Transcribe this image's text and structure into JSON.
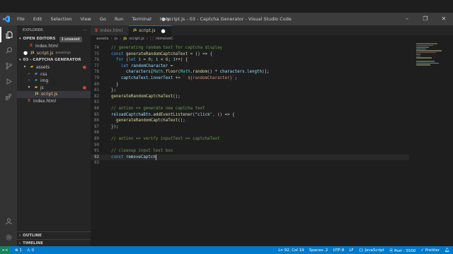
{
  "titlebar": {
    "logo_icon": "vscode-logo",
    "menu": [
      "File",
      "Edit",
      "Selection",
      "View",
      "Go",
      "Run",
      "Terminal",
      "Help"
    ],
    "title": "● script.js - 03 - Captcha Generator - Visual Studio Code",
    "controls": [
      "–",
      "❐",
      "✕"
    ]
  },
  "activity": [
    "files-icon",
    "search-icon",
    "source-control-icon",
    "run-debug-icon",
    "extensions-icon",
    "account-icon",
    "settings-gear-icon"
  ],
  "sidebar": {
    "title": "EXPLORER",
    "more": "···",
    "open_editors": {
      "label": "OPEN EDITORS",
      "badge": "1 unsaved",
      "items": [
        {
          "name": "index.html",
          "sub": ""
        },
        {
          "name": "script.js",
          "sub": "assets\\js"
        }
      ]
    },
    "project": {
      "label": "03 - CAPTCHA GENERATOR",
      "items": [
        {
          "name": "assets"
        },
        {
          "name": "css"
        },
        {
          "name": "img"
        },
        {
          "name": "js"
        },
        {
          "name": "script.js"
        },
        {
          "name": "index.html"
        }
      ]
    },
    "outline": "OUTLINE",
    "timeline": "TIMELINE"
  },
  "editor": {
    "tabs": [
      {
        "name": "index.html",
        "active": false
      },
      {
        "name": "script.js",
        "active": true,
        "dirty": "●"
      }
    ],
    "breadcrumb": [
      "assets",
      "js",
      "script.js",
      "removeC"
    ],
    "lines": [
      {
        "n": "74",
        "text": "  // generating random text for captcha display"
      },
      {
        "n": "75",
        "text": "  const generateRandomCaptchaText = () => {"
      },
      {
        "n": "76",
        "text": "    for (let i = 0; i < 6; i++) {"
      },
      {
        "n": "77",
        "text": "      let randomCharacter ="
      },
      {
        "n": "78",
        "text": "        characters[Math.floor(Math.random() * characters.length)];"
      },
      {
        "n": "79",
        "text": "      captchaText.innerText += ` ${randomCharacter}`;"
      },
      {
        "n": "80",
        "text": "    }"
      },
      {
        "n": "81",
        "text": "  };"
      },
      {
        "n": "82",
        "text": "  generateRandomCaptchaText();"
      },
      {
        "n": "83",
        "text": ""
      },
      {
        "n": "84",
        "text": "  // action => generate new captcha text"
      },
      {
        "n": "85",
        "text": "  reloadCaptchaBtn.addEventListener(\"click\", () => {"
      },
      {
        "n": "86",
        "text": "    generateRandomCaptchaText();"
      },
      {
        "n": "87",
        "text": "  });"
      },
      {
        "n": "88",
        "text": ""
      },
      {
        "n": "89",
        "text": "  // action => verify inputText == captchaText"
      },
      {
        "n": "90",
        "text": ""
      },
      {
        "n": "91",
        "text": "  // cleanup input text box"
      },
      {
        "n": "92",
        "text": "  const removeCaptch"
      },
      {
        "n": "93",
        "text": ""
      }
    ]
  },
  "statusbar": {
    "left": {
      "remote": "><",
      "errors": "⊗ 1",
      "warnings": "⚠ 0"
    },
    "right": [
      "Ln 92, Col 19",
      "Spaces: 2",
      "UTF-8",
      "LF",
      "{} JavaScript",
      "⦿ Port : 5500",
      "✓ Prettier"
    ]
  },
  "colors": {
    "comment": "#6a9955",
    "keyword": "#569cd6",
    "control": "#c586c0",
    "function": "#dcdcaa",
    "variable": "#9cdcfe",
    "string": "#ce9178",
    "number": "#b5cea8",
    "plain": "#d4d4d4"
  }
}
